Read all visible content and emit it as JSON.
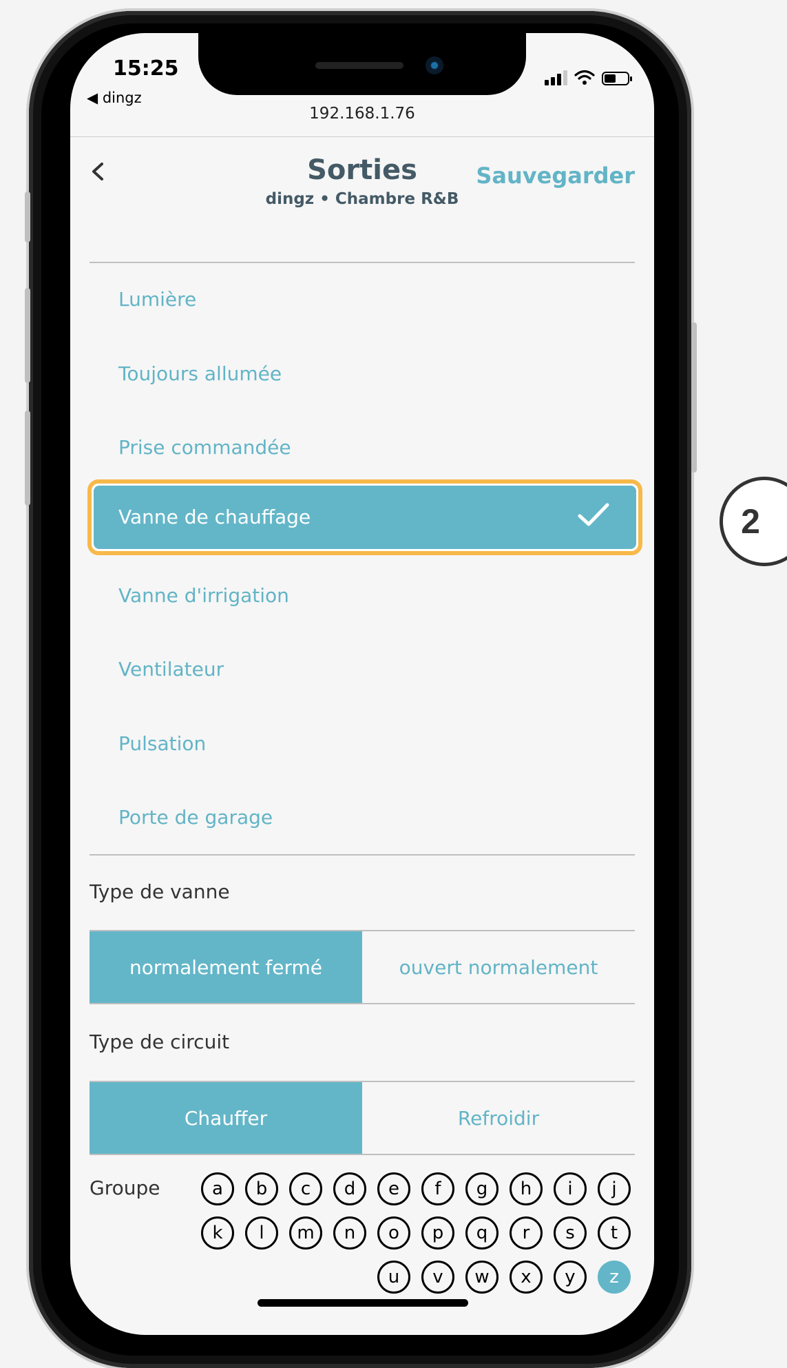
{
  "status_bar": {
    "time": "15:25",
    "back_app": "◀ dingz",
    "url": "192.168.1.76"
  },
  "header": {
    "title": "Sorties",
    "subtitle": "dingz • Chambre R&B",
    "save_label": "Sauvegarder"
  },
  "options": [
    {
      "label": "Lumière",
      "selected": false
    },
    {
      "label": "Toujours allumée",
      "selected": false
    },
    {
      "label": "Prise commandée",
      "selected": false
    },
    {
      "label": "Vanne de chauffage",
      "selected": true
    },
    {
      "label": "Vanne d'irrigation",
      "selected": false
    },
    {
      "label": "Ventilateur",
      "selected": false
    },
    {
      "label": "Pulsation",
      "selected": false
    },
    {
      "label": "Porte de garage",
      "selected": false
    }
  ],
  "valve_type": {
    "label": "Type de vanne",
    "options": [
      "normalement fermé",
      "ouvert normalement"
    ],
    "selected": "normalement fermé"
  },
  "circuit_type": {
    "label": "Type de circuit",
    "options": [
      "Chauffer",
      "Refroidir"
    ],
    "selected": "Chauffer"
  },
  "group": {
    "label": "Groupe",
    "letters": [
      "a",
      "b",
      "c",
      "d",
      "e",
      "f",
      "g",
      "h",
      "i",
      "j",
      "k",
      "l",
      "m",
      "n",
      "o",
      "p",
      "q",
      "r",
      "s",
      "t",
      "u",
      "v",
      "w",
      "x",
      "y",
      "z"
    ],
    "selected": "z"
  },
  "step_badge": "2",
  "colors": {
    "accent": "#63b6c8",
    "highlight_border": "#f7b94a",
    "title": "#445a66"
  }
}
